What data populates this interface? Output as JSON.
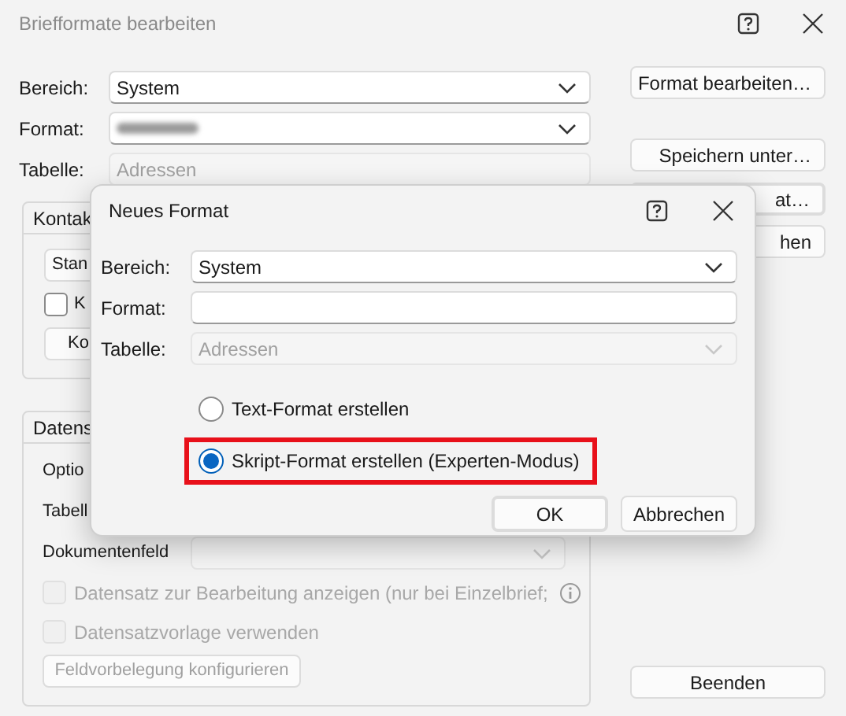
{
  "window": {
    "title": "Briefformate bearbeiten"
  },
  "fields": [
    {
      "label": "Bereich:",
      "kind": "combo",
      "value": "System",
      "disabled": false
    },
    {
      "label": "Format:",
      "kind": "combo_blurred",
      "disabled": false
    },
    {
      "label": "Tabelle:",
      "kind": "text",
      "value": "Adressen",
      "disabled": true
    }
  ],
  "side_buttons": [
    {
      "label": "Format bearbeiten…",
      "focused": false
    },
    {
      "label": "Speichern unter…",
      "focused": false
    },
    {
      "label": "at…",
      "focused": true
    },
    {
      "label": "hen",
      "focused": false
    }
  ],
  "close_button": "Beenden",
  "contact_group": {
    "title": "Kontak",
    "button_1": "Stan",
    "checkbox": {
      "label": "K",
      "checked": false
    },
    "button_2": "Ko"
  },
  "record_group": {
    "title": "Datens",
    "rows": [
      {
        "label": "Optio",
        "kind": "label"
      },
      {
        "label": "Tabell",
        "kind": "label"
      },
      {
        "label": "Dokumentenfeld",
        "kind": "combo",
        "disabled": true
      }
    ],
    "checkboxes": [
      {
        "label": "Datensatz zur Bearbeitung anzeigen (nur bei Einzelbrief;",
        "checked": false,
        "disabled": true,
        "info": true
      },
      {
        "label": "Datensatzvorlage verwenden",
        "checked": false,
        "disabled": true,
        "info": false
      }
    ],
    "button": {
      "label": "Feldvorbelegung konfigurieren",
      "disabled": true
    }
  },
  "dialog": {
    "title": "Neues Format",
    "fields": [
      {
        "label": "Bereich:",
        "kind": "combo",
        "value": "System",
        "disabled": false
      },
      {
        "label": "Format:",
        "kind": "text",
        "disabled": false
      },
      {
        "label": "Tabelle:",
        "kind": "combo",
        "value": "Adressen",
        "disabled": true
      }
    ],
    "options": [
      {
        "label": "Text-Format erstellen",
        "selected": false,
        "highlighted": false
      },
      {
        "label": "Skript-Format erstellen (Experten-Modus)",
        "selected": true,
        "highlighted": true
      }
    ],
    "buttons": [
      {
        "label": "OK",
        "default": true
      },
      {
        "label": "Abbrechen",
        "default": false
      }
    ]
  }
}
